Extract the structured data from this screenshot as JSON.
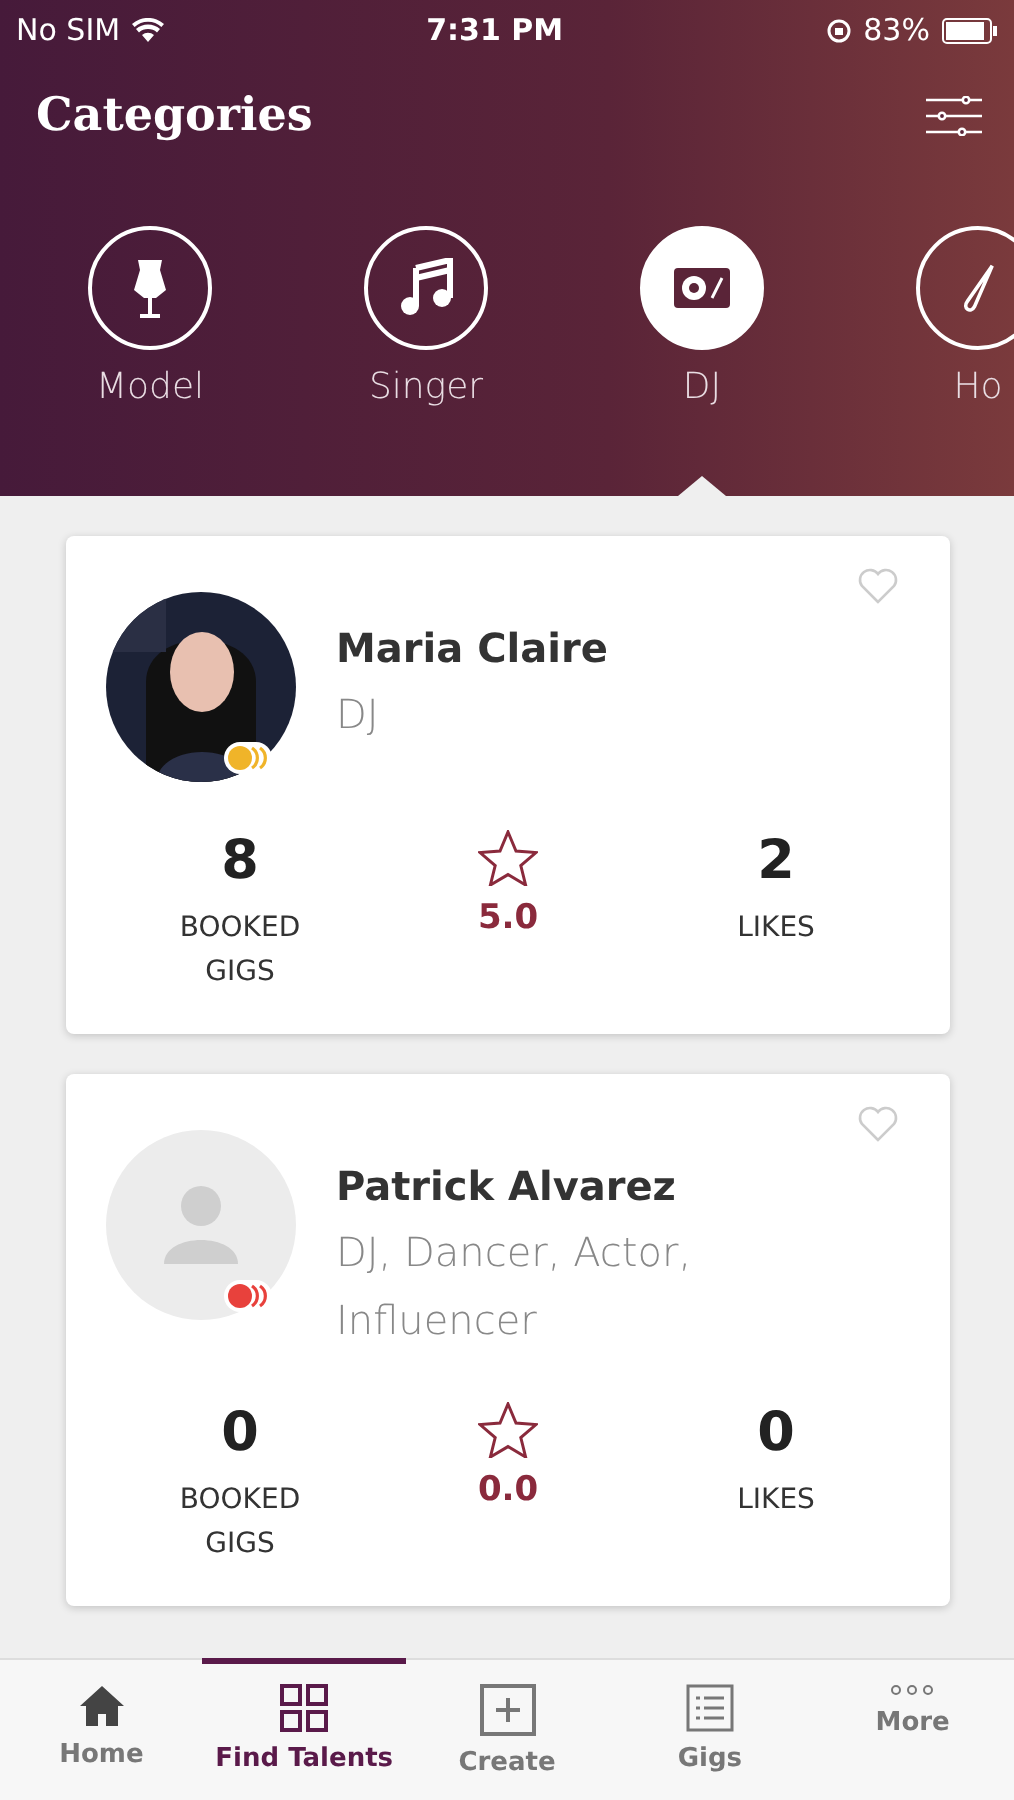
{
  "status_bar": {
    "carrier": "No SIM",
    "time": "7:31 PM",
    "battery": "83%"
  },
  "header": {
    "title": "Categories"
  },
  "categories": [
    {
      "kind": "model",
      "label": "Model",
      "selected": false
    },
    {
      "kind": "singer",
      "label": "Singer",
      "selected": false
    },
    {
      "kind": "dj",
      "label": "DJ",
      "selected": true
    },
    {
      "kind": "brush",
      "label": "Ho",
      "selected": false
    }
  ],
  "talents": [
    {
      "name": "Maria Claire",
      "roles": "DJ",
      "badge": {
        "color": "#f0b429"
      },
      "booked": "8",
      "booked_label": "BOOKED GIGS",
      "rating": "5.0",
      "likes": "2",
      "likes_label": "LIKES"
    },
    {
      "name": "Patrick Alvarez",
      "roles": "DJ, Dancer, Actor, Influencer",
      "avatar": {
        "kind": "placeholder"
      },
      "badge": {
        "color": "#e8413c"
      },
      "booked": "0",
      "booked_label": "BOOKED GIGS",
      "rating": "0.0",
      "likes": "0",
      "likes_label": "LIKES"
    }
  ],
  "tab_bar": [
    {
      "kind": "home",
      "label": "Home",
      "selected": false
    },
    {
      "kind": "grid",
      "label": "Find Talents",
      "selected": true
    },
    {
      "kind": "create",
      "label": "Create",
      "selected": false
    },
    {
      "kind": "list",
      "label": "Gigs",
      "selected": false
    },
    {
      "kind": "more",
      "label": "More",
      "selected": false
    }
  ]
}
